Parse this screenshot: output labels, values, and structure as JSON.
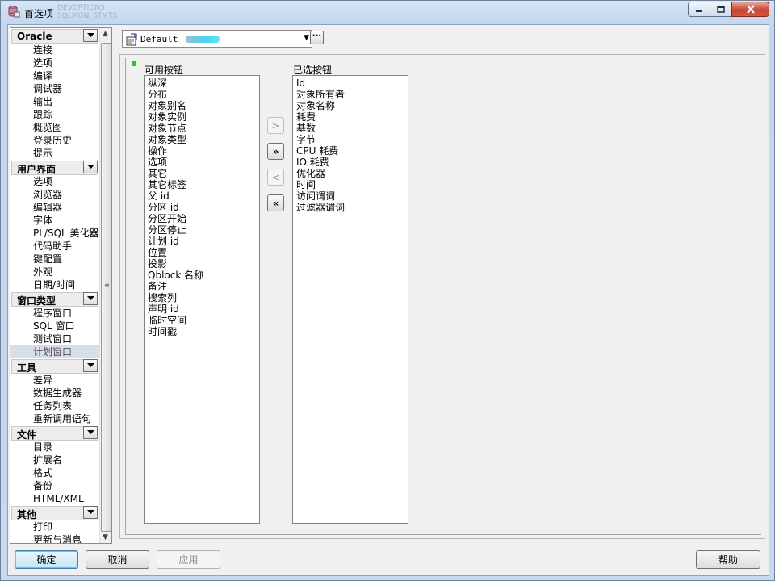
{
  "window": {
    "title": "首选项",
    "title_ghost_lines": [
      "DEVOPTIONS",
      "SQLMON_STMTS"
    ]
  },
  "nav": {
    "groups": [
      {
        "label": "Oracle",
        "items": [
          "连接",
          "选项",
          "编译",
          "调试器",
          "输出",
          "跟踪",
          "概览图",
          "登录历史",
          "提示"
        ]
      },
      {
        "label": "用户界面",
        "items": [
          "选项",
          "浏览器",
          "编辑器",
          "字体",
          "PL/SQL 美化器",
          "代码助手",
          "键配置",
          "外观",
          "日期/时间"
        ]
      },
      {
        "label": "窗口类型",
        "items": [
          "程序窗口",
          "SQL 窗口",
          "测试窗口",
          "计划窗口"
        ],
        "selected_index": 3
      },
      {
        "label": "工具",
        "items": [
          "差异",
          "数据生成器",
          "任务列表",
          "重新调用语句"
        ]
      },
      {
        "label": "文件",
        "items": [
          "目录",
          "扩展名",
          "格式",
          "备份",
          "HTML/XML"
        ]
      },
      {
        "label": "其他",
        "items": [
          "打印",
          "更新与消息"
        ]
      }
    ]
  },
  "template": {
    "value": "Default"
  },
  "available": {
    "label": "可用按钮",
    "items": [
      "纵深",
      "分布",
      "对象别名",
      "对象实例",
      "对象节点",
      "对象类型",
      "操作",
      "选项",
      "其它",
      "其它标签",
      "父 id",
      "分区 id",
      "分区开始",
      "分区停止",
      "计划 id",
      "位置",
      "投影",
      "Qblock 名称",
      "备注",
      "搜索列",
      "声明 id",
      "临时空间",
      "时间戳"
    ]
  },
  "selected": {
    "label": "已选按钮",
    "items": [
      "Id",
      "对象所有者",
      "对象名称",
      "耗费",
      "基数",
      "字节",
      "CPU 耗费",
      "IO 耗费",
      "优化器",
      "时间",
      "访问谓词",
      "过滤器谓词"
    ]
  },
  "move_buttons": {
    "add_one": ">",
    "add_all": "»",
    "remove_one": "<",
    "remove_all": "«"
  },
  "buttons": {
    "ok": "确定",
    "cancel": "取消",
    "apply": "应用",
    "help": "帮助"
  },
  "icons": {
    "title": "database-prefs-icon",
    "template": "template-icon"
  },
  "colors": {
    "marker": "#18d118",
    "close_button": "#c8452f"
  }
}
